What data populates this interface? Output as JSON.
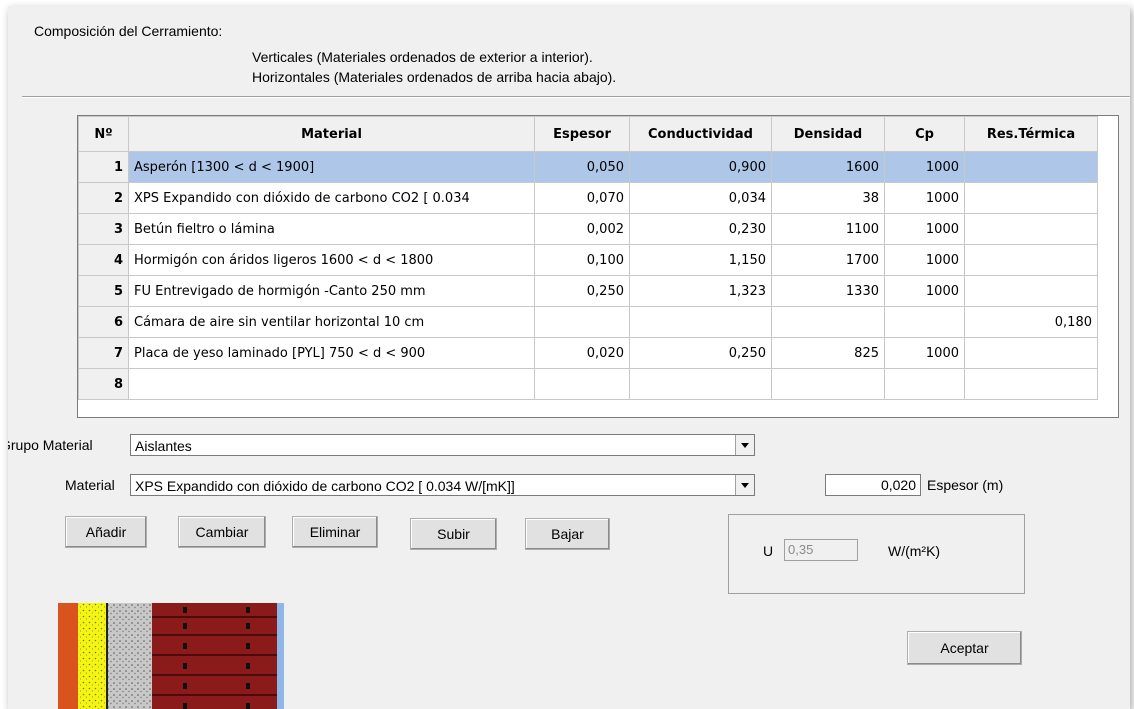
{
  "header": {
    "title": "Composición del Cerramiento:",
    "line1": "Verticales (Materiales ordenados de exterior a interior).",
    "line2": "Horizontales (Materiales ordenados de arriba hacia abajo)."
  },
  "table": {
    "columns": [
      "Nº",
      "Material",
      "Espesor",
      "Conductividad",
      "Densidad",
      "Cp",
      "Res.Térmica"
    ],
    "rows": [
      {
        "n": "1",
        "material": "Asperón [1300 < d < 1900]",
        "espesor": "0,050",
        "conductividad": "0,900",
        "densidad": "1600",
        "cp": "1000",
        "res": ""
      },
      {
        "n": "2",
        "material": "XPS Expandido con dióxido de carbono CO2 [ 0.034",
        "espesor": "0,070",
        "conductividad": "0,034",
        "densidad": "38",
        "cp": "1000",
        "res": ""
      },
      {
        "n": "3",
        "material": "Betún fieltro o lámina",
        "espesor": "0,002",
        "conductividad": "0,230",
        "densidad": "1100",
        "cp": "1000",
        "res": ""
      },
      {
        "n": "4",
        "material": "Hormigón con áridos ligeros 1600 < d < 1800",
        "espesor": "0,100",
        "conductividad": "1,150",
        "densidad": "1700",
        "cp": "1000",
        "res": ""
      },
      {
        "n": "5",
        "material": "FU Entrevigado de hormigón -Canto 250 mm",
        "espesor": "0,250",
        "conductividad": "1,323",
        "densidad": "1330",
        "cp": "1000",
        "res": ""
      },
      {
        "n": "6",
        "material": "Cámara de aire sin ventilar horizontal 10 cm",
        "espesor": "",
        "conductividad": "",
        "densidad": "",
        "cp": "",
        "res": "0,180"
      },
      {
        "n": "7",
        "material": "Placa de yeso laminado [PYL] 750 < d < 900",
        "espesor": "0,020",
        "conductividad": "0,250",
        "densidad": "825",
        "cp": "1000",
        "res": ""
      },
      {
        "n": "8",
        "material": "",
        "espesor": "",
        "conductividad": "",
        "densidad": "",
        "cp": "",
        "res": ""
      }
    ],
    "selected_row": 1
  },
  "form": {
    "grupo_label": "Grupo Material",
    "grupo_value": "Aislantes",
    "material_label": "Material",
    "material_value": "XPS Expandido con dióxido de carbono CO2 [ 0.034 W/[mK]]",
    "espesor_value": "0,020",
    "espesor_label": "Espesor (m)"
  },
  "buttons": {
    "add": "Añadir",
    "change": "Cambiar",
    "delete": "Eliminar",
    "up": "Subir",
    "down": "Bajar",
    "accept": "Aceptar"
  },
  "u_panel": {
    "label": "U",
    "value": "0,35",
    "unit": "W/(m²K)"
  },
  "colors": {
    "selection": "#aec7e8",
    "layer_orange": "#d9531e",
    "layer_yellow": "#f5f514",
    "layer_gray": "#c8c8c8",
    "layer_brick": "#8b1a1a",
    "layer_blue": "#8fb6e8"
  }
}
